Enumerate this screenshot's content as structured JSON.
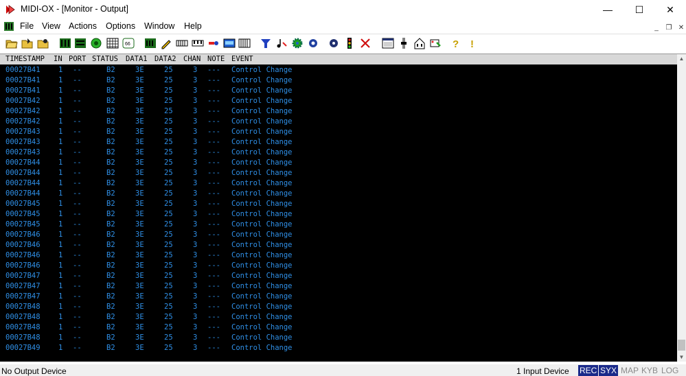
{
  "window": {
    "title": "MIDI-OX - [Monitor - Output]",
    "minimize": "—",
    "maximize": "☐",
    "close": "✕"
  },
  "menu": {
    "items": [
      "File",
      "View",
      "Actions",
      "Options",
      "Window",
      "Help"
    ],
    "mdi_minimize": "_",
    "mdi_restore": "❐",
    "mdi_close": "✕"
  },
  "toolbar": {
    "icons": [
      "open-icon",
      "save-icon",
      "record-icon",
      "port-mapping-icon",
      "keyboard-icon",
      "patch-map-icon",
      "globe-icon",
      "grid-icon",
      "nrpn-icon",
      "status-icon",
      "pen-icon",
      "piano-icon",
      "piano2-icon",
      "midi-plug-icon",
      "lcd-icon",
      "keys-icon",
      "filter-icon",
      "notes-icon",
      "gear-icon",
      "joystick-icon",
      "help-cursor-icon",
      "traffic-light-icon",
      "delete-icon",
      "monitor-in-icon",
      "fader-icon",
      "house-icon",
      "wizard-icon",
      "question-icon",
      "exclamation-icon"
    ]
  },
  "monitor": {
    "headers": [
      "TIMESTAMP",
      "IN",
      "PORT",
      "STATUS",
      "DATA1",
      "DATA2",
      "CHAN",
      "NOTE",
      "EVENT"
    ],
    "rows": [
      [
        "00027B41",
        "1",
        "--",
        "B2",
        "3E",
        "25",
        "3",
        "---",
        "Control Change"
      ],
      [
        "00027B41",
        "1",
        "--",
        "B2",
        "3E",
        "25",
        "3",
        "---",
        "Control Change"
      ],
      [
        "00027B41",
        "1",
        "--",
        "B2",
        "3E",
        "25",
        "3",
        "---",
        "Control Change"
      ],
      [
        "00027B42",
        "1",
        "--",
        "B2",
        "3E",
        "25",
        "3",
        "---",
        "Control Change"
      ],
      [
        "00027B42",
        "1",
        "--",
        "B2",
        "3E",
        "25",
        "3",
        "---",
        "Control Change"
      ],
      [
        "00027B42",
        "1",
        "--",
        "B2",
        "3E",
        "25",
        "3",
        "---",
        "Control Change"
      ],
      [
        "00027B43",
        "1",
        "--",
        "B2",
        "3E",
        "25",
        "3",
        "---",
        "Control Change"
      ],
      [
        "00027B43",
        "1",
        "--",
        "B2",
        "3E",
        "25",
        "3",
        "---",
        "Control Change"
      ],
      [
        "00027B43",
        "1",
        "--",
        "B2",
        "3E",
        "25",
        "3",
        "---",
        "Control Change"
      ],
      [
        "00027B44",
        "1",
        "--",
        "B2",
        "3E",
        "25",
        "3",
        "---",
        "Control Change"
      ],
      [
        "00027B44",
        "1",
        "--",
        "B2",
        "3E",
        "25",
        "3",
        "---",
        "Control Change"
      ],
      [
        "00027B44",
        "1",
        "--",
        "B2",
        "3E",
        "25",
        "3",
        "---",
        "Control Change"
      ],
      [
        "00027B44",
        "1",
        "--",
        "B2",
        "3E",
        "25",
        "3",
        "---",
        "Control Change"
      ],
      [
        "00027B45",
        "1",
        "--",
        "B2",
        "3E",
        "25",
        "3",
        "---",
        "Control Change"
      ],
      [
        "00027B45",
        "1",
        "--",
        "B2",
        "3E",
        "25",
        "3",
        "---",
        "Control Change"
      ],
      [
        "00027B45",
        "1",
        "--",
        "B2",
        "3E",
        "25",
        "3",
        "---",
        "Control Change"
      ],
      [
        "00027B46",
        "1",
        "--",
        "B2",
        "3E",
        "25",
        "3",
        "---",
        "Control Change"
      ],
      [
        "00027B46",
        "1",
        "--",
        "B2",
        "3E",
        "25",
        "3",
        "---",
        "Control Change"
      ],
      [
        "00027B46",
        "1",
        "--",
        "B2",
        "3E",
        "25",
        "3",
        "---",
        "Control Change"
      ],
      [
        "00027B46",
        "1",
        "--",
        "B2",
        "3E",
        "25",
        "3",
        "---",
        "Control Change"
      ],
      [
        "00027B47",
        "1",
        "--",
        "B2",
        "3E",
        "25",
        "3",
        "---",
        "Control Change"
      ],
      [
        "00027B47",
        "1",
        "--",
        "B2",
        "3E",
        "25",
        "3",
        "---",
        "Control Change"
      ],
      [
        "00027B47",
        "1",
        "--",
        "B2",
        "3E",
        "25",
        "3",
        "---",
        "Control Change"
      ],
      [
        "00027B48",
        "1",
        "--",
        "B2",
        "3E",
        "25",
        "3",
        "---",
        "Control Change"
      ],
      [
        "00027B48",
        "1",
        "--",
        "B2",
        "3E",
        "25",
        "3",
        "---",
        "Control Change"
      ],
      [
        "00027B48",
        "1",
        "--",
        "B2",
        "3E",
        "25",
        "3",
        "---",
        "Control Change"
      ],
      [
        "00027B48",
        "1",
        "--",
        "B2",
        "3E",
        "25",
        "3",
        "---",
        "Control Change"
      ],
      [
        "00027B49",
        "1",
        "--",
        "B2",
        "3E",
        "25",
        "3",
        "---",
        "Control Change"
      ]
    ],
    "text_color": "#2f8fe6",
    "background": "#000000"
  },
  "status": {
    "output_device": "No Output Device",
    "input_device": "1 Input Device",
    "indicators": [
      {
        "label": "REC",
        "active": true
      },
      {
        "label": "SYX",
        "active": true
      },
      {
        "label": "MAP",
        "active": false
      },
      {
        "label": "KYB",
        "active": false
      },
      {
        "label": "LOG",
        "active": false
      }
    ]
  }
}
